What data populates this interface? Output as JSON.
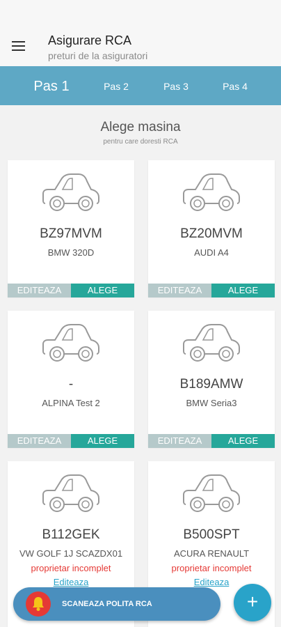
{
  "header": {
    "title": "Asigurare RCA",
    "subtitle": "preturi de la asiguratori"
  },
  "tabs": [
    {
      "label": "Pas 1",
      "active": true
    },
    {
      "label": "Pas 2",
      "active": false
    },
    {
      "label": "Pas 3",
      "active": false
    },
    {
      "label": "Pas 4",
      "active": false
    }
  ],
  "section": {
    "title": "Alege masina",
    "subtitle": "pentru care doresti RCA"
  },
  "cars": [
    {
      "plate": "BZ97MVM",
      "model": "BMW 320D",
      "edit": "EDITEAZA",
      "choose": "ALEGE"
    },
    {
      "plate": "BZ20MVM",
      "model": "AUDI A4",
      "edit": "EDITEAZA",
      "choose": "ALEGE"
    },
    {
      "plate": "-",
      "model": "ALPINA Test 2",
      "edit": "EDITEAZA",
      "choose": "ALEGE"
    },
    {
      "plate": "B189AMW",
      "model": "BMW Seria3",
      "edit": "EDITEAZA",
      "choose": "ALEGE"
    },
    {
      "plate": "B112GEK",
      "model": "VW GOLF 1J SCAZDX01",
      "warning": "proprietar incomplet",
      "link": "Editeaza"
    },
    {
      "plate": "B500SPT",
      "model": "ACURA RENAULT",
      "warning": "proprietar incomplet",
      "link": "Editeaza"
    }
  ],
  "bottom": {
    "scan_label": "SCANEAZA POLITA RCA",
    "fab_label": "+"
  },
  "colors": {
    "tab_bar": "#5ea8c5",
    "choose": "#26a79a",
    "edit": "#b5c9ca",
    "warning": "#e53935",
    "link": "#29a3c9",
    "scan_button": "#4a8fbe"
  }
}
